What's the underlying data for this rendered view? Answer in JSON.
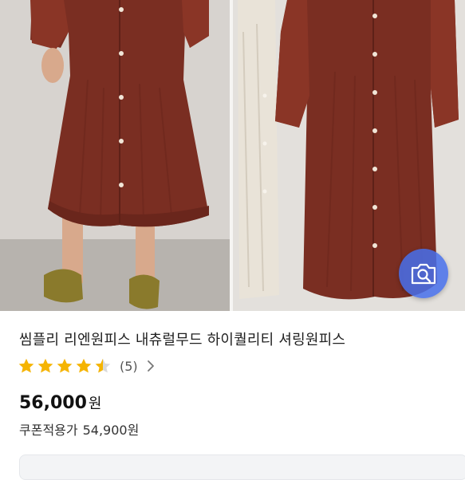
{
  "product": {
    "title": "씸플리 리엔원피스 내츄럴무드 하이퀄리티 셔링원피스",
    "rating_value": 4.5,
    "review_count": "(5)",
    "price": "56,000",
    "price_unit": "원",
    "coupon_label": "쿠폰적용가",
    "coupon_price": "54,900원"
  },
  "icons": {
    "image_search": "camera-search-icon",
    "review_chevron": "chevron-right-icon",
    "star": "star-icon"
  },
  "colors": {
    "star": "#f5b400",
    "search_button": "#466eeb",
    "dress": "#7a2e22"
  }
}
